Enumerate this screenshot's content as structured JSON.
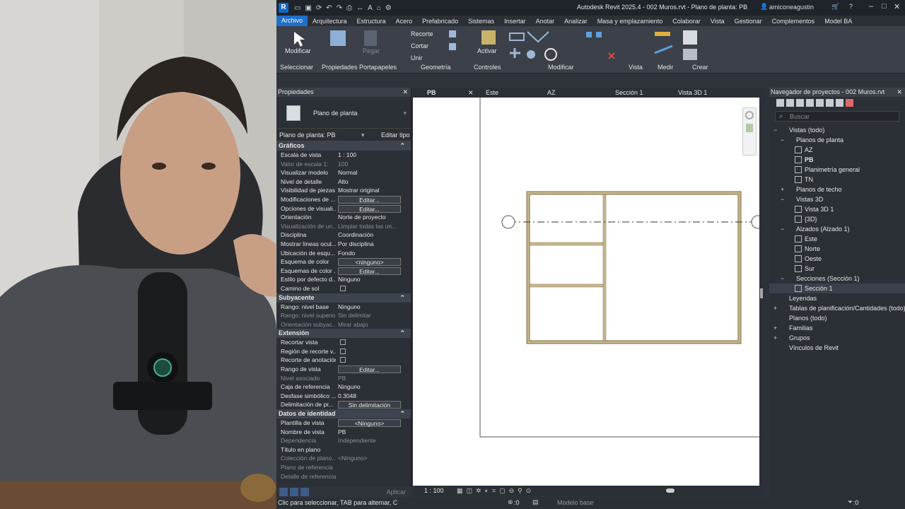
{
  "window": {
    "title": "Autodesk Revit 2025.4 - 002 Muros.rvt - Plano de planta: PB",
    "user": "amiconeagustin",
    "logo": "R"
  },
  "ribbon_tabs": [
    "Archivo",
    "Arquitectura",
    "Estructura",
    "Acero",
    "Prefabricado",
    "Sistemas",
    "Insertar",
    "Anotar",
    "Analizar",
    "Masa y emplazamiento",
    "Colaborar",
    "Vista",
    "Gestionar",
    "Complementos",
    "Model BA"
  ],
  "ribbon": {
    "modify_label": "Modificar",
    "paste_label": "Pegar",
    "cut_label": "Cortar",
    "join_label": "Unir",
    "recorte_label": "Recorte",
    "activate_label": "Activar",
    "groups": [
      "Seleccionar",
      "Propiedades",
      "Portapapeles",
      "Geometría",
      "Controles",
      "Modificar",
      "Vista",
      "Medir",
      "Crear"
    ]
  },
  "properties": {
    "title": "Propiedades",
    "type_name": "Plano de planta",
    "instance": "Plano de planta: PB",
    "edit_type": "Editar tipo",
    "sections": [
      {
        "name": "Gráficos",
        "rows": [
          {
            "k": "Escala de vista",
            "v": "1 : 100"
          },
          {
            "k": "Valor de escala   1:",
            "v": "100",
            "dim": true
          },
          {
            "k": "Visualizar modelo",
            "v": "Normal"
          },
          {
            "k": "Nivel de detalle",
            "v": "Alto"
          },
          {
            "k": "Visibilidad de piezas",
            "v": "Mostrar original"
          },
          {
            "k": "Modificaciones de ...",
            "v": "Editar...",
            "btn": true
          },
          {
            "k": "Opciones de visuali...",
            "v": "Editar...",
            "btn": true
          },
          {
            "k": "Orientación",
            "v": "Norte de proyecto"
          },
          {
            "k": "Visualización de un...",
            "v": "Limpiar todas las un...",
            "dim": true
          },
          {
            "k": "Disciplina",
            "v": "Coordinación"
          },
          {
            "k": "Mostrar líneas ocul...",
            "v": "Por disciplina"
          },
          {
            "k": "Ubicación de esqu...",
            "v": "Fondo"
          },
          {
            "k": "Esquema de color",
            "v": "<ninguno>",
            "btn": true
          },
          {
            "k": "Esquemas de color ...",
            "v": "Editar...",
            "btn": true
          },
          {
            "k": "Estilo por defecto d...",
            "v": "Ninguno"
          },
          {
            "k": "Camino de sol",
            "v": "",
            "chk": true
          }
        ]
      },
      {
        "name": "Subyacente",
        "rows": [
          {
            "k": "Rango: nivel base",
            "v": "Ninguno"
          },
          {
            "k": "Rango: nivel superior",
            "v": "Sin delimitar",
            "dim": true
          },
          {
            "k": "Orientación subyac...",
            "v": "Mirar abajo",
            "dim": true
          }
        ]
      },
      {
        "name": "Extensión",
        "rows": [
          {
            "k": "Recortar vista",
            "v": "",
            "chk": true
          },
          {
            "k": "Región de recorte v...",
            "v": "",
            "chk": true
          },
          {
            "k": "Recorte de anotación",
            "v": "",
            "chk": true
          },
          {
            "k": "Rango de vista",
            "v": "Editar...",
            "btn": true
          },
          {
            "k": "Nivel asociado",
            "v": "PB",
            "dim": true
          },
          {
            "k": "Caja de referencia",
            "v": "Ninguno"
          },
          {
            "k": "Desfase simbólico ...",
            "v": "0.3048"
          },
          {
            "k": "Delimitación de pr...",
            "v": "Sin delimitación",
            "btn": true
          }
        ]
      },
      {
        "name": "Datos de identidad",
        "rows": [
          {
            "k": "Plantilla de vista",
            "v": "<Ninguno>",
            "btn": true
          },
          {
            "k": "Nombre de vista",
            "v": "PB"
          },
          {
            "k": "Dependencia",
            "v": "Independiente",
            "dim": true
          },
          {
            "k": "Título en plano",
            "v": ""
          },
          {
            "k": "Colección de plano...",
            "v": "<Ninguno>",
            "dim": true
          },
          {
            "k": "Plano de referencia",
            "v": "",
            "dim": true
          },
          {
            "k": "Detalle de referencia",
            "v": "",
            "dim": true
          }
        ]
      }
    ],
    "apply": "Aplicar"
  },
  "view_tabs": [
    "PB",
    "Este",
    "AZ",
    "Sección 1",
    "Vista 3D 1"
  ],
  "view_scale": "1 : 100",
  "browser": {
    "title": "Navegador de proyectos - 002 Muros.rvt",
    "search_placeholder": "Buscar",
    "tree": [
      {
        "label": "Vistas (todo)",
        "level": 0,
        "exp": "−"
      },
      {
        "label": "Planos de planta",
        "level": 1,
        "exp": "−"
      },
      {
        "label": "AZ",
        "level": 2
      },
      {
        "label": "PB",
        "level": 2,
        "bold": true
      },
      {
        "label": "Planimetría general",
        "level": 2
      },
      {
        "label": "TN",
        "level": 2
      },
      {
        "label": "Planos de techo",
        "level": 1,
        "exp": "+"
      },
      {
        "label": "Vistas 3D",
        "level": 1,
        "exp": "−"
      },
      {
        "label": "Vista 3D 1",
        "level": 2
      },
      {
        "label": "{3D}",
        "level": 2
      },
      {
        "label": "Alzados (Alzado 1)",
        "level": 1,
        "exp": "−"
      },
      {
        "label": "Este",
        "level": 2
      },
      {
        "label": "Norte",
        "level": 2
      },
      {
        "label": "Oeste",
        "level": 2
      },
      {
        "label": "Sur",
        "level": 2
      },
      {
        "label": "Secciones (Sección 1)",
        "level": 1,
        "exp": "−"
      },
      {
        "label": "Sección 1",
        "level": 2,
        "sel": true
      },
      {
        "label": "Leyendas",
        "level": 0
      },
      {
        "label": "Tablas de planificación/Cantidades (todo)",
        "level": 0,
        "exp": "+"
      },
      {
        "label": "Planos (todo)",
        "level": 0
      },
      {
        "label": "Familias",
        "level": 0,
        "exp": "+"
      },
      {
        "label": "Grupos",
        "level": 0,
        "exp": "+"
      },
      {
        "label": "Vínculos de Revit",
        "level": 0
      }
    ]
  },
  "status": {
    "hint": "Clic para seleccionar, TAB para alternar, C",
    "model": "Modelo base",
    "sel_count": ":0",
    "filter_count": ":0"
  }
}
